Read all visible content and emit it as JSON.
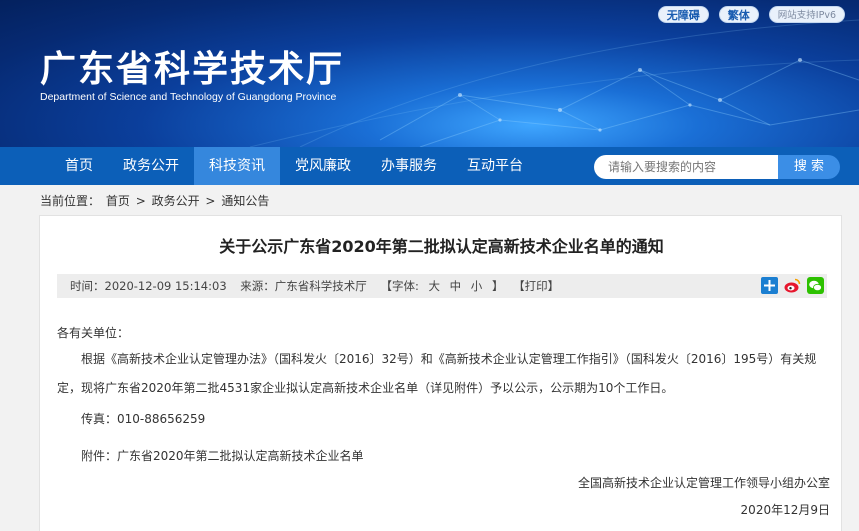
{
  "header": {
    "title": "广东省科学技术厅",
    "subtitle": "Department of Science and Technology of Guangdong Province",
    "top_links": [
      "无障碍",
      "繁体",
      "网站支持IPv6"
    ]
  },
  "nav": {
    "items": [
      {
        "label": "首页",
        "active": false
      },
      {
        "label": "政务公开",
        "active": false
      },
      {
        "label": "科技资讯",
        "active": true
      },
      {
        "label": "党风廉政",
        "active": false
      },
      {
        "label": "办事服务",
        "active": false
      },
      {
        "label": "互动平台",
        "active": false
      }
    ],
    "search_placeholder": "请输入要搜索的内容",
    "search_button": "搜 索"
  },
  "breadcrumb": {
    "prefix": "当前位置：",
    "items": [
      "首页",
      "政务公开",
      "通知公告"
    ],
    "separator": ">"
  },
  "article": {
    "title": "关于公示广东省2020年第二批拟认定高新技术企业名单的通知",
    "meta": {
      "time": "时间：2020-12-09 15:14:03",
      "source": "来源：广东省科学技术厅",
      "font_label": "【字体:",
      "font_large": "大",
      "font_medium": "中",
      "font_small": "小",
      "font_close": "】",
      "print": "【打印】"
    },
    "share_icons": [
      "add-share-icon",
      "weibo-icon",
      "wechat-icon"
    ],
    "salutation": "各有关单位：",
    "paragraph": "根据《高新技术企业认定管理办法》（国科发火〔2016〕32号）和《高新技术企业认定管理工作指引》（国科发火〔2016〕195号）有关规定，现将广东省2020年第二批4531家企业拟认定高新技术企业名单（详见附件）予以公示，公示期为10个工作日。",
    "fax": "传真：010-88656259",
    "attachment": "附件：广东省2020年第二批拟认定高新技术企业名单",
    "sign_org": "全国高新技术企业认定管理工作领导小组办公室",
    "sign_date": "2020年12月9日"
  },
  "colors": {
    "nav_bg": "#0c5fb8",
    "nav_active": "#3587dd",
    "search_button": "#3b8ee6"
  }
}
